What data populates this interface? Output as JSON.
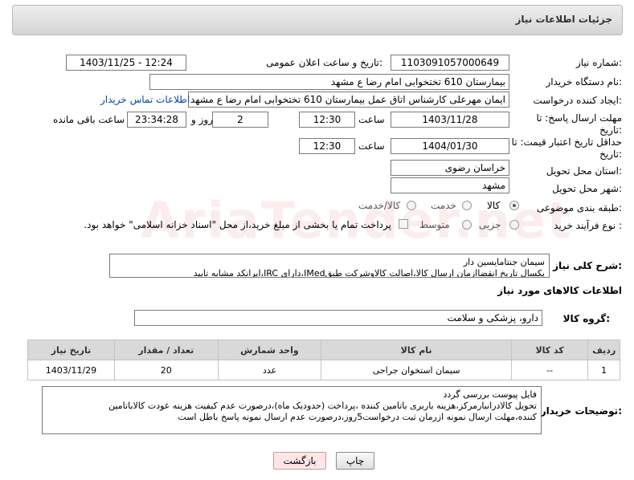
{
  "header": {
    "title": "جزئیات اطلاعات نیاز"
  },
  "fields": {
    "need_number_label": "شماره نیاز:",
    "need_number": "1103091057000649",
    "announce_label": "تاریخ و ساعت اعلان عمومی:",
    "announce_value": "1403/11/25 - 12:24",
    "buyer_org_label": "نام دستگاه خریدار:",
    "buyer_org": "بیمارستان 610 تختخوابی امام رضا ع  مشهد",
    "creator_label": "ایجاد کننده درخواست:",
    "creator": "ایمان مهرعلی کارشناس اتاق عمل بیمارستان 610 تختخوابی امام رضا ع  مشهد",
    "buyer_contact_link": "اطلاعات تماس خریدار",
    "deadline_label_1": "مهلت ارسال پاسخ: تا",
    "deadline_label_2": "تاریخ:",
    "deadline_date": "1403/11/28",
    "time_label": "ساعت",
    "deadline_time": "12:30",
    "days_value": "2",
    "days_label": "روز و",
    "remaining_time": "23:34:28",
    "remaining_label": "ساعت باقی مانده",
    "validity_label_1": "حداقل تاریخ اعتبار قیمت: تا",
    "validity_label_2": "تاریخ:",
    "validity_date": "1404/01/30",
    "validity_time": "12:30",
    "province_label": "استان محل تحویل:",
    "province": "خراسان رضوی",
    "city_label": "شهر محل تحویل:",
    "city": "مشهد",
    "category_label": "طبقه بندی موضوعی:",
    "category_options": [
      "کالا",
      "خدمت",
      "کالا/خدمت"
    ],
    "process_label": "نوع فرآیند خرید :",
    "process_options": [
      "جزیی",
      "متوسط"
    ],
    "payment_note": "پرداخت تمام یا بخشی از مبلغ خرید،از محل \"اسناد خزانه اسلامی\" خواهد بود."
  },
  "description": {
    "label": "شرح کلی نیاز:",
    "line1": "سیمان جنتامایسین دار",
    "line2": "یکسال تاریخ انقضاازمان ارسال کالا،اصالت کالاوشرکت طبقIMed،دارای IRC،ایرانکد مشابه تایید"
  },
  "goods_section": {
    "title": "اطلاعات کالاهای مورد نیاز",
    "group_label": "گروه کالا:",
    "group_value": "دارو، پزشکی و سلامت"
  },
  "table": {
    "headers": [
      "ردیف",
      "کد کالا",
      "نام کالا",
      "واحد شمارش",
      "تعداد / مقدار",
      "تاریخ نیاز"
    ],
    "rows": [
      [
        "1",
        "--",
        "سیمان استخوان جراحی",
        "عدد",
        "20",
        "1403/11/29"
      ]
    ]
  },
  "buyer_notes": {
    "label": "توضیحات خریدار:",
    "line1": "فایل پیوست بررسی گردد",
    "line2": "تحویل کالادرانبارمرکز،هزینه باربری باتامین کننده ،پرداخت (حدودیک ماه)،درصورت عدم کیفیت هزینه عودت کالاباتامین",
    "line3": "کننده،مهلت ارسال نمونه ازرمان ثبت درخواست5روز،درصورت عدم ارسال نمونه پاسخ باطل است"
  },
  "buttons": {
    "print": "چاپ",
    "back": "بازگشت"
  },
  "watermark": "AriaTender.net"
}
